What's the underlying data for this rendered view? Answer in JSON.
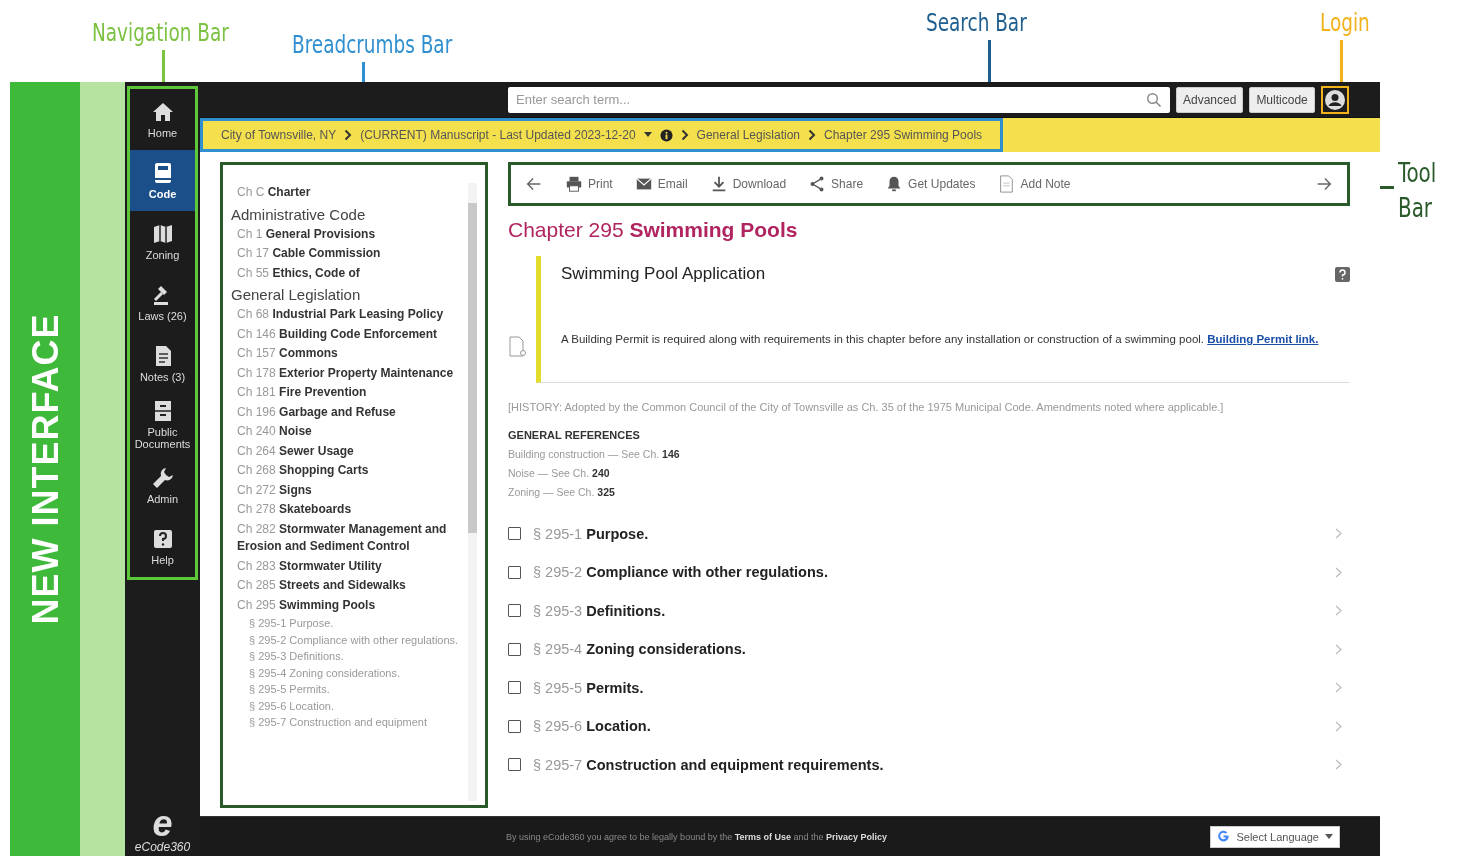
{
  "annotations": [
    {
      "label": "Navigation Bar",
      "color": "#7cc242"
    },
    {
      "label": "Breadcrumbs Bar",
      "color": "#2f8fd0"
    },
    {
      "label": "Search Bar",
      "color": "#1f5f8f"
    },
    {
      "label": "Login",
      "color": "#f2b21b"
    },
    {
      "label": "Tool Bar",
      "color": "#2a5a2a"
    }
  ],
  "side_label": "NEW INTERFACE",
  "nav": {
    "items": [
      {
        "kind": "home",
        "label": "Home",
        "selected": false
      },
      {
        "kind": "book",
        "label": "Code",
        "selected": true
      },
      {
        "kind": "map",
        "label": "Zoning",
        "selected": false
      },
      {
        "kind": "gavel",
        "label": "Laws (26)",
        "selected": false
      },
      {
        "kind": "note",
        "label": "Notes (3)",
        "selected": false
      },
      {
        "kind": "cabinet",
        "label": "Public Documents",
        "selected": false
      },
      {
        "kind": "wrench",
        "label": "Admin",
        "selected": false
      },
      {
        "kind": "help",
        "label": "Help",
        "selected": false
      }
    ],
    "logo": {
      "mark": "e",
      "name": "eCode360"
    }
  },
  "search": {
    "placeholder": "Enter search term...",
    "buttons": [
      "Advanced",
      "Multicode"
    ]
  },
  "breadcrumbs": [
    {
      "kind": "link",
      "label": "City of Townsville, NY"
    },
    {
      "kind": "version",
      "label": "(CURRENT) Manuscript - Last Updated 2023-12-20"
    },
    {
      "kind": "link",
      "label": "General Legislation"
    },
    {
      "kind": "link",
      "label": "Chapter 295 Swimming Pools"
    }
  ],
  "tree": [
    {
      "kind": "chapter",
      "num": "Ch C",
      "title": "Charter"
    },
    {
      "kind": "heading",
      "label": "Administrative Code"
    },
    {
      "kind": "chapter",
      "num": "Ch 1",
      "title": "General Provisions"
    },
    {
      "kind": "chapter",
      "num": "Ch 17",
      "title": "Cable Commission"
    },
    {
      "kind": "chapter",
      "num": "Ch 55",
      "title": "Ethics, Code of"
    },
    {
      "kind": "heading",
      "label": "General Legislation"
    },
    {
      "kind": "chapter",
      "num": "Ch 68",
      "title": "Industrial Park Leasing Policy"
    },
    {
      "kind": "chapter",
      "num": "Ch 146",
      "title": "Building Code Enforcement"
    },
    {
      "kind": "chapter",
      "num": "Ch 157",
      "title": "Commons"
    },
    {
      "kind": "chapter",
      "num": "Ch 178",
      "title": "Exterior Property Maintenance"
    },
    {
      "kind": "chapter",
      "num": "Ch 181",
      "title": "Fire Prevention"
    },
    {
      "kind": "chapter",
      "num": "Ch 196",
      "title": "Garbage and Refuse"
    },
    {
      "kind": "chapter",
      "num": "Ch 240",
      "title": "Noise"
    },
    {
      "kind": "chapter",
      "num": "Ch 264",
      "title": "Sewer Usage"
    },
    {
      "kind": "chapter",
      "num": "Ch 268",
      "title": "Shopping Carts"
    },
    {
      "kind": "chapter",
      "num": "Ch 272",
      "title": "Signs"
    },
    {
      "kind": "chapter",
      "num": "Ch 278",
      "title": "Skateboards"
    },
    {
      "kind": "chapter",
      "num": "Ch 282",
      "title": "Stormwater Management and Erosion and Sediment Control"
    },
    {
      "kind": "chapter",
      "num": "Ch 283",
      "title": "Stormwater Utility"
    },
    {
      "kind": "chapter",
      "num": "Ch 285",
      "title": "Streets and Sidewalks"
    },
    {
      "kind": "chapter",
      "num": "Ch 295",
      "title": "Swimming Pools",
      "expanded": true,
      "children": [
        {
          "kind": "section",
          "label": "§ 295-1 Purpose."
        },
        {
          "kind": "section",
          "label": "§ 295-2 Compliance with other regulations."
        },
        {
          "kind": "section",
          "label": "§ 295-3 Definitions."
        },
        {
          "kind": "section",
          "label": "§ 295-4 Zoning considerations."
        },
        {
          "kind": "section",
          "label": "§ 295-5 Permits."
        },
        {
          "kind": "section",
          "label": "§ 295-6 Location."
        },
        {
          "kind": "section",
          "label": "§ 295-7 Construction and equipment"
        }
      ]
    }
  ],
  "toolbar": [
    {
      "kind": "back"
    },
    {
      "kind": "print",
      "label": "Print"
    },
    {
      "kind": "email",
      "label": "Email"
    },
    {
      "kind": "download",
      "label": "Download"
    },
    {
      "kind": "share",
      "label": "Share"
    },
    {
      "kind": "updates",
      "label": "Get Updates"
    },
    {
      "kind": "note",
      "label": "Add Note"
    },
    {
      "kind": "forward"
    }
  ],
  "chapter": {
    "num": "Chapter 295",
    "title": "Swimming Pools"
  },
  "note": {
    "title": "Swimming Pool Application",
    "text": "A Building Permit is required along with requirements in this chapter before any installation or construction of a swimming pool.",
    "link": "Building Permit link."
  },
  "history": "[HISTORY: Adopted by the Common Council of the City of Townsville as Ch. 35 of the 1975 Municipal Code. Amendments noted where applicable.]",
  "references": {
    "title": "GENERAL REFERENCES",
    "items": [
      {
        "text": "Building construction — See Ch.",
        "ref": "146"
      },
      {
        "text": "Noise — See Ch.",
        "ref": "240"
      },
      {
        "text": "Zoning — See Ch.",
        "ref": "325"
      }
    ]
  },
  "sections": [
    {
      "num": "§ 295-1",
      "title": "Purpose.",
      "checked": false
    },
    {
      "num": "§ 295-2",
      "title": "Compliance with other regulations.",
      "checked": false
    },
    {
      "num": "§ 295-3",
      "title": "Definitions.",
      "checked": false
    },
    {
      "num": "§ 295-4",
      "title": "Zoning considerations.",
      "checked": false
    },
    {
      "num": "§ 295-5",
      "title": "Permits.",
      "checked": false
    },
    {
      "num": "§ 295-6",
      "title": "Location.",
      "checked": false
    },
    {
      "num": "§ 295-7",
      "title": "Construction and equipment requirements.",
      "checked": false
    }
  ],
  "footer": {
    "text": "By using eCode360 you agree to be legally bound by the",
    "links": [
      "Terms of Use",
      "Privacy Policy"
    ],
    "joiner": "and the",
    "language": "Select Language"
  }
}
